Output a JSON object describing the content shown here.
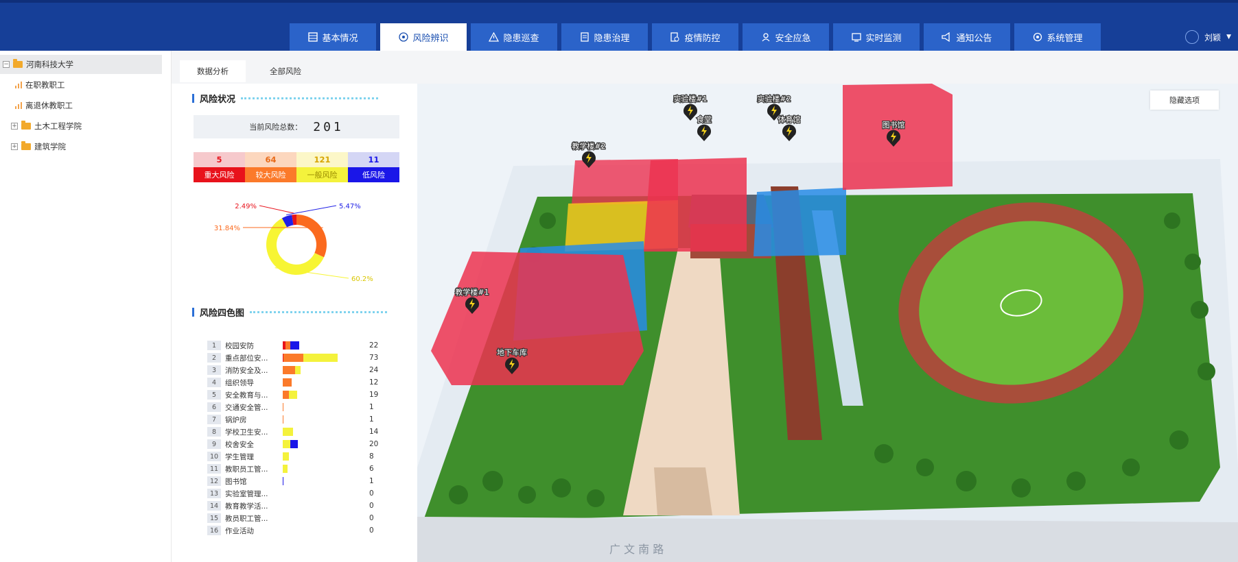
{
  "header": {
    "tabs": [
      {
        "label": "基本情况",
        "icon": "grid-icon"
      },
      {
        "label": "风险辨识",
        "icon": "target-icon",
        "active": true
      },
      {
        "label": "隐患巡查",
        "icon": "warning-icon"
      },
      {
        "label": "隐患治理",
        "icon": "document-icon"
      },
      {
        "label": "疫情防控",
        "icon": "shield-doc-icon"
      },
      {
        "label": "安全应急",
        "icon": "person-icon"
      },
      {
        "label": "实时监测",
        "icon": "monitor-icon"
      },
      {
        "label": "通知公告",
        "icon": "megaphone-icon"
      },
      {
        "label": "系统管理",
        "icon": "gear-icon"
      }
    ],
    "user": "刘颖"
  },
  "tree": {
    "root": "河南科技大学",
    "items": [
      {
        "label": "在职教职工",
        "type": "leaf"
      },
      {
        "label": "离退休教职工",
        "type": "leaf"
      },
      {
        "label": "土木工程学院",
        "type": "folder"
      },
      {
        "label": "建筑学院",
        "type": "folder"
      }
    ]
  },
  "subtabs": [
    "数据分析",
    "全部风险"
  ],
  "risk_overview": {
    "title": "风险状况",
    "total_label": "当前风险总数：",
    "total": "201",
    "levels": [
      {
        "count": "5",
        "name": "重大风险",
        "color": "#e8121b",
        "light": "#f6c9cc"
      },
      {
        "count": "64",
        "name": "较大风险",
        "color": "#fb7a2a",
        "light": "#fcd7be"
      },
      {
        "count": "121",
        "name": "一般风险",
        "color": "#f4f23c",
        "light": "#fcf7c8"
      },
      {
        "count": "11",
        "name": "低风险",
        "color": "#1a16e8",
        "light": "#d4d6f5"
      }
    ]
  },
  "chart_data": {
    "type": "pie",
    "labels": [
      "重大风险",
      "较大风险",
      "一般风险",
      "低风险"
    ],
    "values": [
      2.49,
      31.84,
      60.2,
      5.47
    ],
    "value_labels": [
      "2.49%",
      "31.84%",
      "60.2%",
      "5.47%"
    ],
    "colors": [
      "#e8121b",
      "#fb6a1e",
      "#f7f534",
      "#2021e6"
    ]
  },
  "risk_four_color": {
    "title": "风险四色图",
    "rows": [
      {
        "idx": "1",
        "name": "校园安防",
        "value": "22",
        "segs": [
          4,
          6,
          0,
          12
        ]
      },
      {
        "idx": "2",
        "name": "重点部位安...",
        "value": "73",
        "segs": [
          1,
          26,
          46,
          0
        ]
      },
      {
        "idx": "3",
        "name": "消防安全及...",
        "value": "24",
        "segs": [
          0,
          16,
          8,
          0
        ]
      },
      {
        "idx": "4",
        "name": "组织领导",
        "value": "12",
        "segs": [
          0,
          12,
          0,
          0
        ]
      },
      {
        "idx": "5",
        "name": "安全教育与...",
        "value": "19",
        "segs": [
          0,
          8,
          11,
          0
        ]
      },
      {
        "idx": "6",
        "name": "交通安全管...",
        "value": "1",
        "segs": [
          0,
          1,
          0,
          0
        ]
      },
      {
        "idx": "7",
        "name": "锅炉房",
        "value": "1",
        "segs": [
          0,
          1,
          0,
          0
        ]
      },
      {
        "idx": "8",
        "name": "学校卫生安...",
        "value": "14",
        "segs": [
          0,
          0,
          14,
          0
        ]
      },
      {
        "idx": "9",
        "name": "校舍安全",
        "value": "20",
        "segs": [
          0,
          0,
          10,
          10
        ]
      },
      {
        "idx": "10",
        "name": "学生管理",
        "value": "8",
        "segs": [
          0,
          0,
          8,
          0
        ]
      },
      {
        "idx": "11",
        "name": "教职员工管...",
        "value": "6",
        "segs": [
          0,
          0,
          6,
          0
        ]
      },
      {
        "idx": "12",
        "name": "图书馆",
        "value": "1",
        "segs": [
          0,
          0,
          0,
          1
        ]
      },
      {
        "idx": "13",
        "name": "实验室管理...",
        "value": "0",
        "segs": [
          0,
          0,
          0,
          0
        ]
      },
      {
        "idx": "14",
        "name": "教育教学活...",
        "value": "0",
        "segs": [
          0,
          0,
          0,
          0
        ]
      },
      {
        "idx": "15",
        "name": "教员职工管...",
        "value": "0",
        "segs": [
          0,
          0,
          0,
          0
        ]
      },
      {
        "idx": "16",
        "name": "作业活动",
        "value": "0",
        "segs": [
          0,
          0,
          0,
          0
        ]
      }
    ]
  },
  "map": {
    "hide_button": "隐藏选项",
    "labels": [
      "实验楼#1",
      "实验楼#2",
      "食堂",
      "体育馆",
      "教学楼#2",
      "图书馆",
      "教学楼#1",
      "地下车库"
    ],
    "road": "广 文 南 路"
  }
}
